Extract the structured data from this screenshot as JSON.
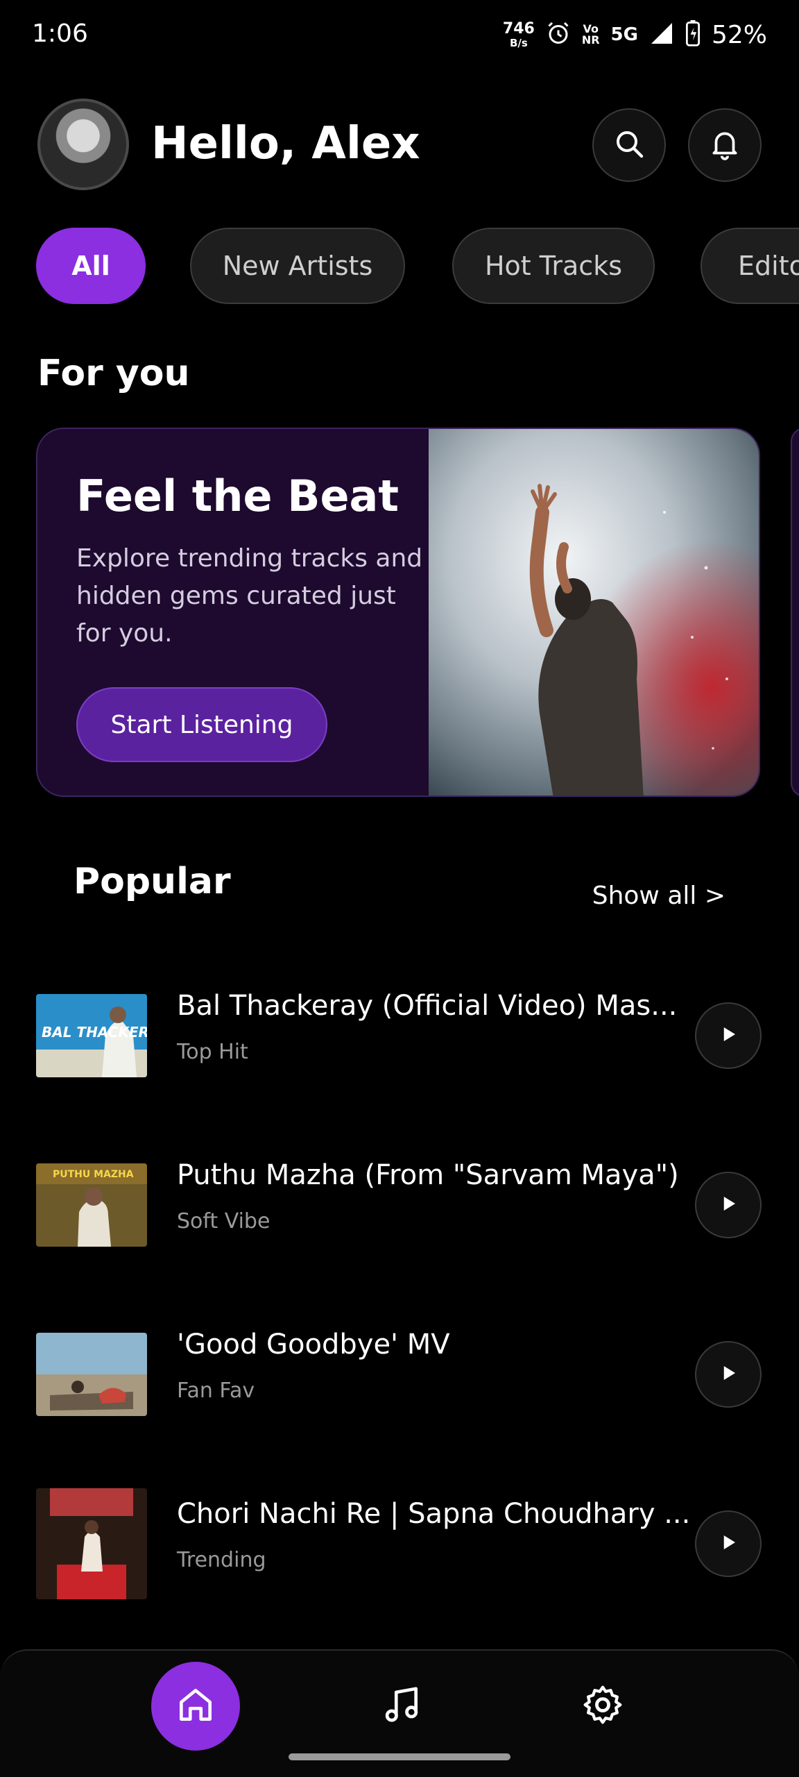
{
  "status_bar": {
    "time": "1:06",
    "net_speed_value": "746",
    "net_speed_unit": "B/s",
    "volte_top": "Vo",
    "volte_bottom": "NR",
    "network": "5G",
    "battery": "52%",
    "icons": [
      "alarm-icon",
      "signal-icon",
      "battery-icon"
    ]
  },
  "header": {
    "greeting": "Hello, Alex",
    "icons": [
      "search-icon",
      "bell-icon"
    ]
  },
  "chips": [
    {
      "label": "All",
      "active": true
    },
    {
      "label": "New Artists",
      "active": false
    },
    {
      "label": "Hot Tracks",
      "active": false
    },
    {
      "label": "Editors",
      "active": false
    }
  ],
  "for_you": {
    "section_title": "For you",
    "card": {
      "title": "Feel the Beat",
      "description": "Explore trending tracks and hidden gems curated just for you.",
      "button_label": "Start Listening"
    }
  },
  "popular": {
    "section_title": "Popular",
    "show_all": "Show all >",
    "tracks": [
      {
        "title": "Bal Thackeray (Official Video) Mas...",
        "subtitle": "Top Hit",
        "thumb_text": "BAL THACKERAY"
      },
      {
        "title": "Puthu Mazha (From \"Sarvam Maya\")",
        "subtitle": "Soft Vibe",
        "thumb_text": "PUTHU MAZHA"
      },
      {
        "title": "'Good Goodbye' MV",
        "subtitle": "Fan Fav",
        "thumb_text": ""
      },
      {
        "title": "Chori Nachi Re | Sapna Choudhary ...",
        "subtitle": "Trending",
        "thumb_text": ""
      }
    ]
  },
  "bottom_nav": {
    "items": [
      {
        "name": "home",
        "icon": "home-icon",
        "active": true
      },
      {
        "name": "music",
        "icon": "music-note-icon",
        "active": false
      },
      {
        "name": "settings",
        "icon": "gear-icon",
        "active": false
      }
    ]
  },
  "colors": {
    "accent": "#8b2fe0",
    "card_bg": "#1e0a2e",
    "button_purple": "#5b22a0"
  }
}
